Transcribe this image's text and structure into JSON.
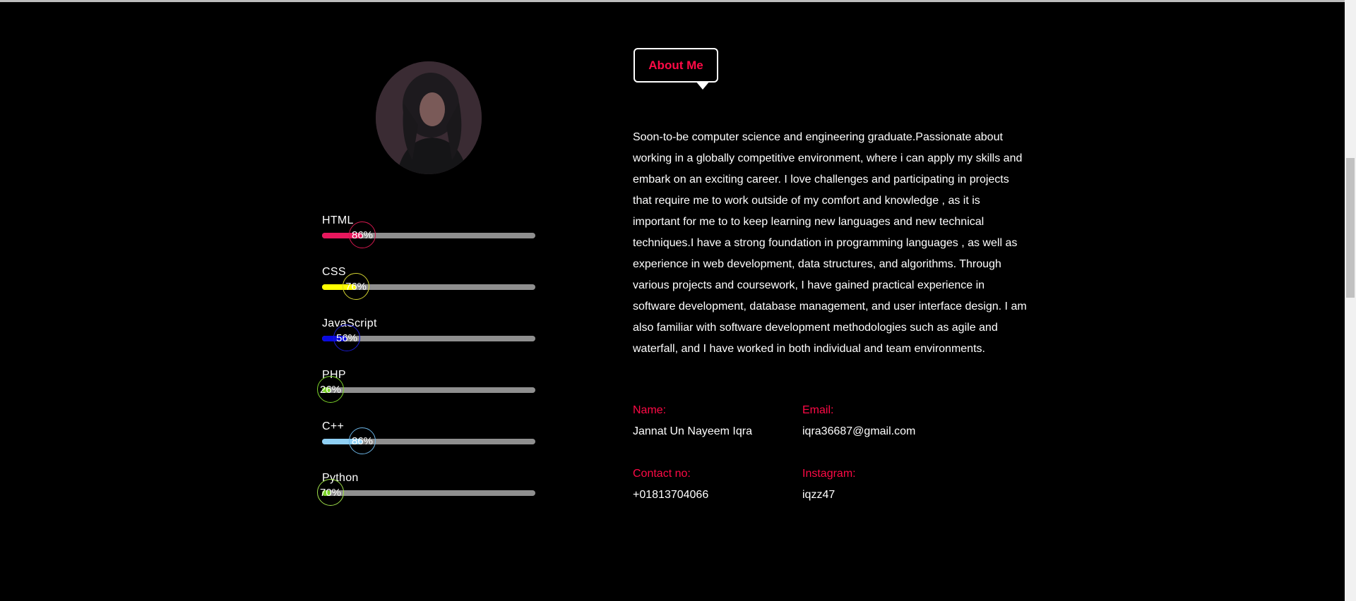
{
  "about": {
    "badge": "About Me",
    "paragraph": "Soon-to-be computer science and engineering graduate.Passionate about working in a globally competitive environment, where i can apply my skills and embark on an exciting career. I love challenges and participating in projects that require me to work outside of my comfort and knowledge , as it is important for me to to keep learning new languages and new technical techniques.I have a strong foundation in programming languages , as well as experience in web development, data structures, and algorithms. Through various projects and coursework, I have gained practical experience in software development, database management, and user interface design. I am also familiar with software development methodologies such as agile and waterfall, and I have worked in both individual and team environments."
  },
  "info": {
    "name_label": "Name:",
    "name_value": "Jannat Un Nayeem Iqra",
    "email_label": "Email:",
    "email_value": "iqra36687@gmail.com",
    "contact_label": "Contact no:",
    "contact_value": "+01813704066",
    "instagram_label": "Instagram:",
    "instagram_value": "iqzz47"
  },
  "skills": [
    {
      "name": "HTML",
      "percent_label": "86%",
      "fill_fraction": 0.19,
      "color": "#e8175d",
      "ring": "#d6184f"
    },
    {
      "name": "CSS",
      "percent_label": "76%",
      "fill_fraction": 0.16,
      "color": "#ffff00",
      "ring": "#d4d431"
    },
    {
      "name": "JavaScript",
      "percent_label": "56%",
      "fill_fraction": 0.115,
      "color": "#0a0ae0",
      "ring": "#1b1bd0"
    },
    {
      "name": "PHP",
      "percent_label": "26%",
      "fill_fraction": 0.04,
      "color": "#7cd42a",
      "ring": "#7cd42a"
    },
    {
      "name": "C++",
      "percent_label": "86%",
      "fill_fraction": 0.19,
      "color": "#8fd0f5",
      "ring": "#6cb5e6"
    },
    {
      "name": "Python",
      "percent_label": "70%",
      "fill_fraction": 0.04,
      "color": "#7cd42a",
      "ring": "#9fe04a"
    }
  ]
}
